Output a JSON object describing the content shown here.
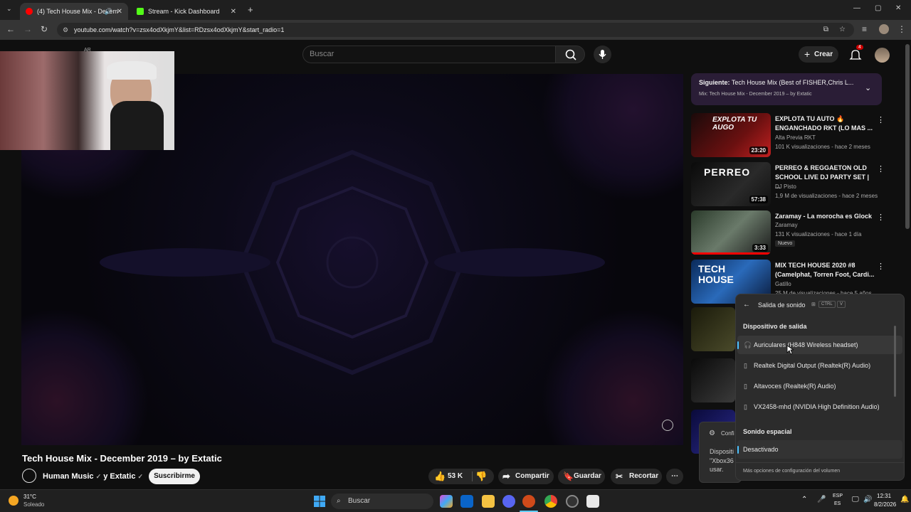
{
  "browser": {
    "tabs": [
      {
        "label": "(4) Tech House Mix - Decem",
        "active": true,
        "color": "#ff0000"
      },
      {
        "label": "Stream - Kick Dashboard",
        "active": false,
        "color": "#53fc18"
      }
    ],
    "url": "youtube.com/watch?v=zsx4odXkjmY&list=RDzsx4odXkjmY&start_radio=1"
  },
  "youtube": {
    "logo_suffix": "AR",
    "search_placeholder": "Buscar",
    "create_label": "Crear",
    "notification_count": "4",
    "video": {
      "title": "Tech House Mix - December 2019 – by Extatic",
      "channel": "Human Music",
      "channel_connector": "y Extatic",
      "subscribe_label": "Suscribirme",
      "likes": "53 K",
      "share_label": "Compartir",
      "save_label": "Guardar",
      "clip_label": "Recortar"
    },
    "up_next": {
      "prefix": "Siguiente:",
      "title": "Tech House Mix (Best of FISHER,Chris L...",
      "subtitle": "Mix: Tech House Mix - December 2019 – by Extatic"
    },
    "recommendations": [
      {
        "title": "EXPLOTA TU AUTO 🔥 ENGANCHADO RKT (LO MAS ...",
        "channel": "Alta Previa RKT",
        "stats": "101 K visualizaciones - hace 2 meses",
        "duration": "23:20",
        "badge": ""
      },
      {
        "title": "PERREO & REGGAETON OLD SCHOOL LIVE DJ PARTY SET | ...",
        "channel": "DJ Pisto",
        "stats": "1,9 M de visualizaciones - hace 2 meses",
        "duration": "57:38",
        "badge": ""
      },
      {
        "title": "Zaramay - La morocha es Glock",
        "channel": "Zaramay",
        "stats": "131 K visualizaciones - hace 1 día",
        "duration": "3:33",
        "badge": "Nuevo"
      },
      {
        "title": "MIX TECH HOUSE 2020 #8 (Camelphat, Torren Foot, Cardi...",
        "channel": "Gatillo",
        "stats": "25 M de visualizaciones - hace 5 años",
        "duration": "",
        "badge": ""
      }
    ],
    "thumb_texts": [
      "EXPLOTA TU AUGO",
      "PERREO",
      "",
      "TECH HOUSE"
    ]
  },
  "sound_flyout": {
    "title": "Salida de sonido",
    "shortcut_ctrl": "CTRL",
    "shortcut_v": "V",
    "section_output": "Dispositivo de salida",
    "devices": [
      {
        "label": "Auriculares (H848 Wireless headset)",
        "selected": true,
        "icon": "headphones-icon"
      },
      {
        "label": "Realtek Digital Output (Realtek(R) Audio)",
        "selected": false,
        "icon": "speaker-icon"
      },
      {
        "label": "Altavoces (Realtek(R) Audio)",
        "selected": false,
        "icon": "speaker-icon"
      },
      {
        "label": "VX2458-mhd (NVIDIA High Definition Audio)",
        "selected": false,
        "icon": "speaker-icon"
      }
    ],
    "section_spatial": "Sonido espacial",
    "spatial_value": "Desactivado",
    "more_settings": "Más opciones de configuración del volumen"
  },
  "toast": {
    "line1": "Confi",
    "line2": "Dispositi",
    "line3": "\"Xbox36",
    "line4": "usar."
  },
  "taskbar": {
    "temperature": "31°C",
    "weather": "Soleado",
    "search_placeholder": "Buscar",
    "lang_top": "ESP",
    "lang_bottom": "ES",
    "time": "12:31",
    "date": "8/2/2026"
  }
}
